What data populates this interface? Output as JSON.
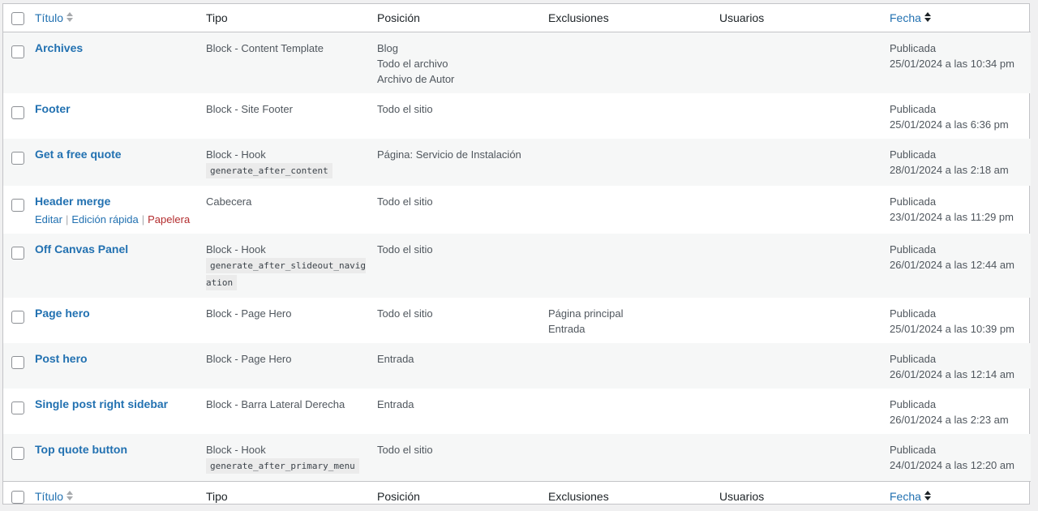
{
  "columns": {
    "title": "Título",
    "tipo": "Tipo",
    "posicion": "Posición",
    "exclusiones": "Exclusiones",
    "usuarios": "Usuarios",
    "fecha": "Fecha"
  },
  "row_actions": {
    "edit": "Editar",
    "quick_edit": "Edición rápida",
    "trash": "Papelera",
    "sep": "|"
  },
  "rows": [
    {
      "title": "Archives",
      "tipo": "Block - Content Template",
      "hook": "",
      "posicion": [
        "Blog",
        "Todo el archivo",
        "Archivo de Autor"
      ],
      "exclusiones": [],
      "status": "Publicada",
      "date": "25/01/2024 a las 10:34 pm"
    },
    {
      "title": "Footer",
      "tipo": "Block - Site Footer",
      "hook": "",
      "posicion": [
        "Todo el sitio"
      ],
      "exclusiones": [],
      "status": "Publicada",
      "date": "25/01/2024 a las 6:36 pm"
    },
    {
      "title": "Get a free quote",
      "tipo": "Block - Hook",
      "hook": "generate_after_content",
      "posicion": [
        "Página: Servicio de Instalación"
      ],
      "exclusiones": [],
      "status": "Publicada",
      "date": "28/01/2024 a las 2:18 am"
    },
    {
      "title": "Header merge",
      "tipo": "Cabecera",
      "hook": "",
      "posicion": [
        "Todo el sitio"
      ],
      "exclusiones": [],
      "status": "Publicada",
      "date": "23/01/2024 a las 11:29 pm"
    },
    {
      "title": "Off Canvas Panel",
      "tipo": "Block - Hook",
      "hook": "generate_after_slideout_navigation",
      "posicion": [
        "Todo el sitio"
      ],
      "exclusiones": [],
      "status": "Publicada",
      "date": "26/01/2024 a las 12:44 am"
    },
    {
      "title": "Page hero",
      "tipo": "Block - Page Hero",
      "hook": "",
      "posicion": [
        "Todo el sitio"
      ],
      "exclusiones": [
        "Página principal",
        "Entrada"
      ],
      "status": "Publicada",
      "date": "25/01/2024 a las 10:39 pm"
    },
    {
      "title": "Post hero",
      "tipo": "Block - Page Hero",
      "hook": "",
      "posicion": [
        "Entrada"
      ],
      "exclusiones": [],
      "status": "Publicada",
      "date": "26/01/2024 a las 12:14 am"
    },
    {
      "title": "Single post right sidebar",
      "tipo": "Block - Barra Lateral Derecha",
      "hook": "",
      "posicion": [
        "Entrada"
      ],
      "exclusiones": [],
      "status": "Publicada",
      "date": "26/01/2024 a las 2:23 am"
    },
    {
      "title": "Top quote button",
      "tipo": "Block - Hook",
      "hook": "generate_after_primary_menu",
      "posicion": [
        "Todo el sitio"
      ],
      "exclusiones": [],
      "status": "Publicada",
      "date": "24/01/2024 a las 12:20 am"
    }
  ]
}
